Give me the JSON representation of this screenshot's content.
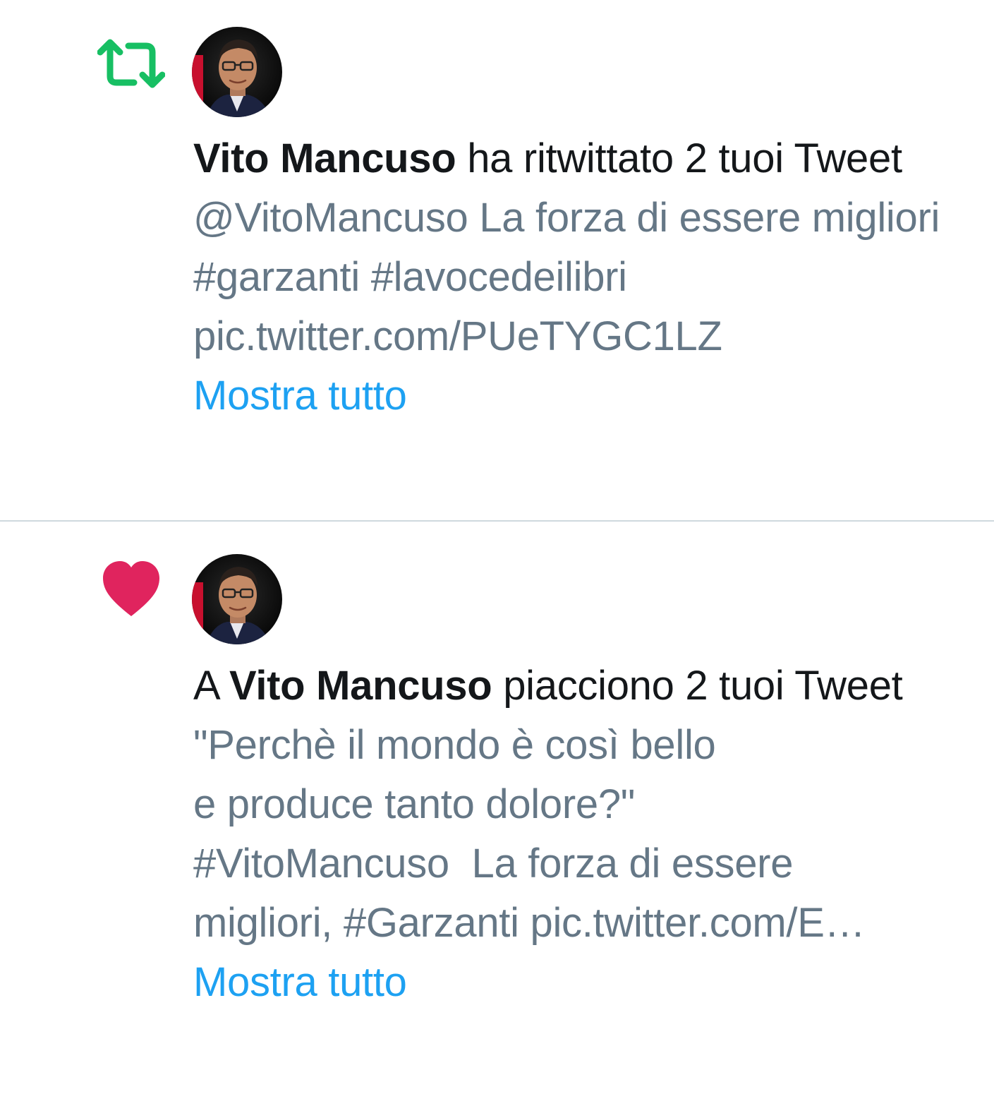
{
  "colors": {
    "retweet_green": "#17bf63",
    "like_red": "#e0245e",
    "link_blue": "#1da1f2",
    "secondary_text": "#657786",
    "primary_text": "#14171a",
    "divider": "#cfd9de"
  },
  "notifications": [
    {
      "type_icon": "retweet-icon",
      "user_name": "Vito Mancuso",
      "text_prefix": "",
      "text_suffix": " ha ritwittato 2 tuoi Tweet",
      "preview": "@VitoMancuso La forza di essere migliori #garzanti #lavocedeilibri pic.twitter.com/PUeTYGC1LZ",
      "show_all": "Mostra tutto"
    },
    {
      "type_icon": "heart-icon",
      "user_name": "Vito Mancuso",
      "text_prefix": "A ",
      "text_suffix": " piacciono 2 tuoi Tweet",
      "preview": "\"Perchè il mondo è così bello\ne produce tanto dolore?\"\n#VitoMancuso  La forza di essere\nmigliori, #Garzanti pic.twitter.com/E…",
      "show_all": "Mostra tutto"
    }
  ]
}
